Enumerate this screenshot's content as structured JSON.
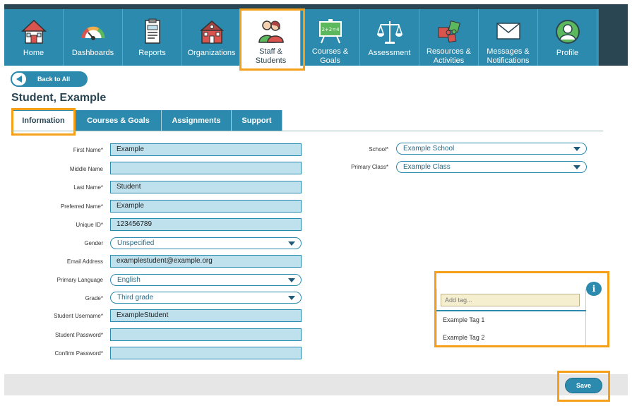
{
  "nav": {
    "items": [
      {
        "label": "Home",
        "icon": "home-icon"
      },
      {
        "label": "Dashboards",
        "icon": "gauge-icon"
      },
      {
        "label": "Reports",
        "icon": "report-icon"
      },
      {
        "label": "Organizations",
        "icon": "school-icon"
      },
      {
        "label": "Staff & Students",
        "icon": "people-icon"
      },
      {
        "label": "Courses & Goals",
        "icon": "chalkboard-icon"
      },
      {
        "label": "Assessment",
        "icon": "scales-icon"
      },
      {
        "label": "Resources & Activities",
        "icon": "puzzle-icon"
      },
      {
        "label": "Messages & Notifications",
        "icon": "envelope-icon"
      },
      {
        "label": "Profile",
        "icon": "avatar-icon"
      }
    ],
    "active": "Staff & Students",
    "colors": {
      "bar": "#2b8aad",
      "dark": "#2b4653",
      "highlight": "#f6a01a"
    }
  },
  "back_button": {
    "label": "Back to All"
  },
  "page_title": "Student, Example",
  "tabs": [
    {
      "label": "Information",
      "active": true
    },
    {
      "label": "Courses & Goals",
      "active": false
    },
    {
      "label": "Assignments",
      "active": false
    },
    {
      "label": "Support",
      "active": false
    }
  ],
  "form": {
    "first_name": {
      "label": "First Name*",
      "value": "Example"
    },
    "middle_name": {
      "label": "Middle Name",
      "value": ""
    },
    "last_name": {
      "label": "Last Name*",
      "value": "Student"
    },
    "preferred_name": {
      "label": "Preferred Name*",
      "value": "Example"
    },
    "unique_id": {
      "label": "Unique ID*",
      "value": "123456789"
    },
    "gender": {
      "label": "Gender",
      "value": "Unspecified"
    },
    "email": {
      "label": "Email Address",
      "value": "examplestudent@example.org"
    },
    "language": {
      "label": "Primary Language",
      "value": "English"
    },
    "grade": {
      "label": "Grade*",
      "value": "Third grade"
    },
    "username": {
      "label": "Student Username*",
      "value": "ExampleStudent"
    },
    "password": {
      "label": "Student Password*",
      "value": ""
    },
    "confirm_password": {
      "label": "Confirm Password*",
      "value": ""
    },
    "school": {
      "label": "School*",
      "value": "Example School"
    },
    "primary_class": {
      "label": "Primary Class*",
      "value": "Example Class"
    }
  },
  "tags": {
    "placeholder": "Add tag...",
    "options": [
      "Example Tag 1",
      "Example Tag 2"
    ]
  },
  "save_button": {
    "label": "Save"
  }
}
